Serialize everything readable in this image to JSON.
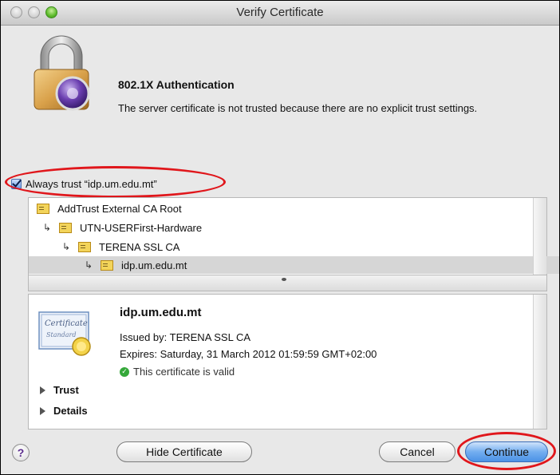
{
  "window": {
    "title": "Verify Certificate"
  },
  "dialog": {
    "heading": "802.1X Authentication",
    "message": "The server certificate is not trusted because there are no explicit trust settings."
  },
  "trust": {
    "checked": true,
    "label": "Always trust “idp.um.edu.mt”"
  },
  "tree": {
    "items": [
      {
        "label": "AddTrust External CA Root",
        "level": 0
      },
      {
        "label": "UTN-USERFirst-Hardware",
        "level": 1
      },
      {
        "label": "TERENA SSL CA",
        "level": 2
      },
      {
        "label": "idp.um.edu.mt",
        "level": 3,
        "selected": true
      }
    ]
  },
  "certificate": {
    "name": "idp.um.edu.mt",
    "issued_by": "Issued by: TERENA SSL CA",
    "expires": "Expires: Saturday, 31 March 2012 01:59:59 GMT+02:00",
    "status": "This certificate is valid",
    "badge_line1": "Certificate",
    "badge_line2": "Standard"
  },
  "sections": {
    "trust": "Trust",
    "details": "Details"
  },
  "buttons": {
    "help": "?",
    "hide_certificate": "Hide Certificate",
    "cancel": "Cancel",
    "continue": "Continue"
  },
  "colors": {
    "highlight_circle": "#e0161b",
    "default_button": "#4b92e6",
    "valid": "#35a83a"
  }
}
